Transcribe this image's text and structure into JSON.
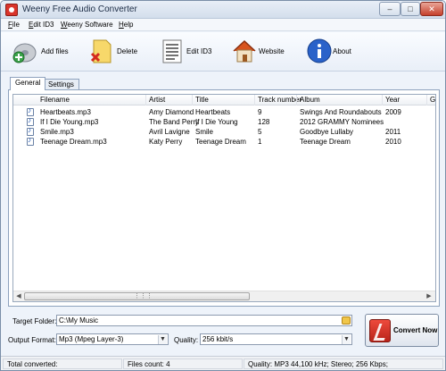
{
  "window": {
    "title": "Weeny Free Audio Converter"
  },
  "menu": [
    "File",
    "Edit ID3",
    "Weeny Software",
    "Help"
  ],
  "toolbar": {
    "add_files": "Add files",
    "delete": "Delete",
    "edit_id3": "Edit ID3",
    "website": "Website",
    "about": "About"
  },
  "tabs": {
    "general": "General",
    "settings": "Settings"
  },
  "table": {
    "headers": {
      "filename": "Filename",
      "artist": "Artist",
      "title": "Title",
      "track": "Track number",
      "album": "Album",
      "year": "Year",
      "genre": "Ge"
    },
    "rows": [
      {
        "filename": "Heartbeats.mp3",
        "artist": "Amy Diamond",
        "title": "Heartbeats",
        "track": "9",
        "album": "Swings And Roundabouts",
        "year": "2009"
      },
      {
        "filename": "If I Die Young.mp3",
        "artist": "The Band Perry",
        "title": "If I Die Young",
        "track": "128",
        "album": "2012 GRAMMY Nominees",
        "year": ""
      },
      {
        "filename": "Smile.mp3",
        "artist": "Avril Lavigne",
        "title": "Smile",
        "track": "5",
        "album": "Goodbye Lullaby",
        "year": "2011"
      },
      {
        "filename": "Teenage Dream.mp3",
        "artist": "Katy Perry",
        "title": "Teenage Dream",
        "track": "1",
        "album": "Teenage Dream",
        "year": "2010"
      }
    ]
  },
  "target_folder": {
    "label": "Target Folder:",
    "value": "C:\\My Music"
  },
  "output_format": {
    "label": "Output Format:",
    "value": "Mp3 (Mpeg Layer-3)"
  },
  "quality": {
    "label": "Quality:",
    "value": "256 kbit/s"
  },
  "convert_button": "Convert Now",
  "status": {
    "total": "Total converted:",
    "files_count": "Files count: 4",
    "quality_info": "Quality: MP3 44,100 kHz; Stereo;  256 Kbps;"
  }
}
